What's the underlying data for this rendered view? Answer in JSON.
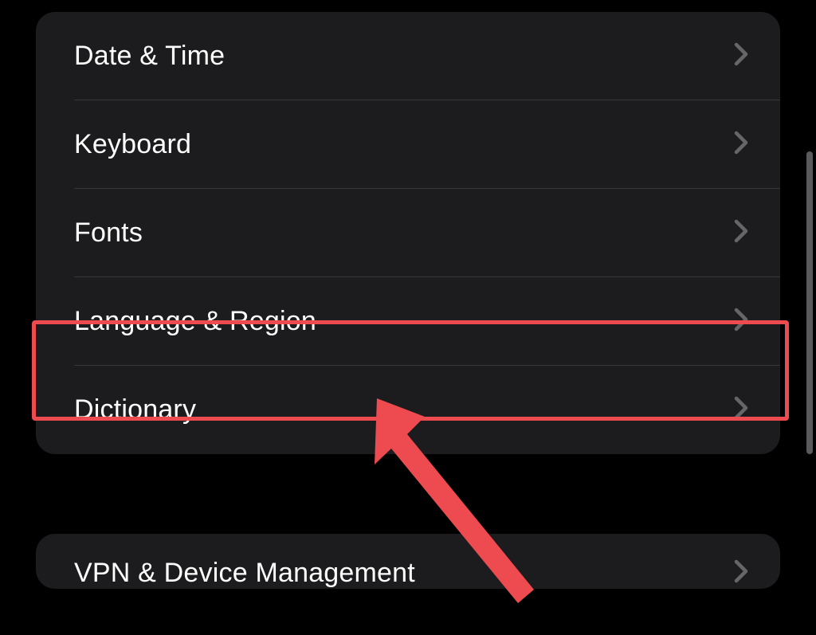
{
  "group1": {
    "items": [
      {
        "label": "Date & Time"
      },
      {
        "label": "Keyboard"
      },
      {
        "label": "Fonts"
      },
      {
        "label": "Language & Region"
      },
      {
        "label": "Dictionary"
      }
    ]
  },
  "group2": {
    "items": [
      {
        "label": "VPN & Device Management"
      }
    ]
  },
  "annotation": {
    "highlight_item_index": 3,
    "highlight_color": "#ed4b4f"
  }
}
